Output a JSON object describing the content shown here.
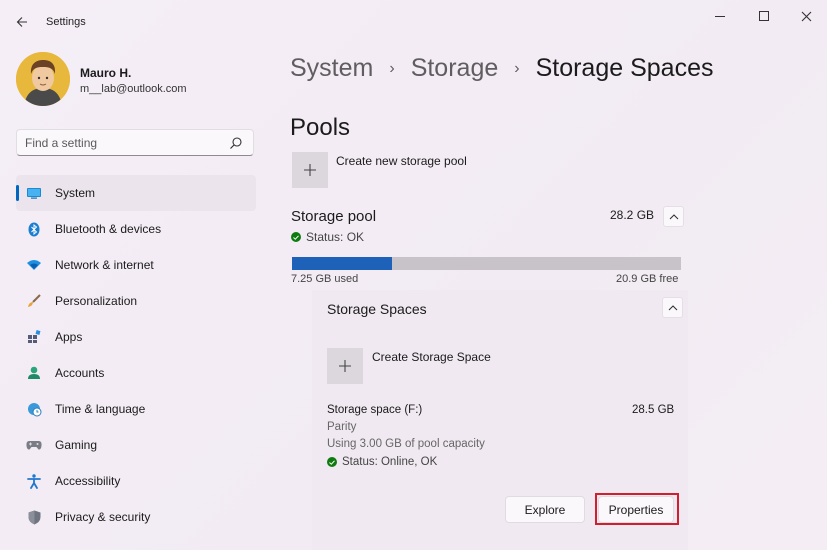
{
  "window": {
    "title": "Settings",
    "back_icon": "arrow-left-icon",
    "minimize_icon": "minimize-icon",
    "maximize_icon": "maximize-icon",
    "close_icon": "close-icon"
  },
  "profile": {
    "name": "Mauro H.",
    "email": "m__lab@outlook.com"
  },
  "search": {
    "placeholder": "Find a setting",
    "icon": "search-icon"
  },
  "nav": {
    "items": [
      {
        "label": "System",
        "icon": "monitor-icon",
        "active": true
      },
      {
        "label": "Bluetooth & devices",
        "icon": "bluetooth-icon"
      },
      {
        "label": "Network & internet",
        "icon": "wifi-icon"
      },
      {
        "label": "Personalization",
        "icon": "brush-icon"
      },
      {
        "label": "Apps",
        "icon": "apps-icon"
      },
      {
        "label": "Accounts",
        "icon": "person-icon"
      },
      {
        "label": "Time & language",
        "icon": "globe-clock-icon"
      },
      {
        "label": "Gaming",
        "icon": "gamepad-icon"
      },
      {
        "label": "Accessibility",
        "icon": "accessibility-icon"
      },
      {
        "label": "Privacy & security",
        "icon": "shield-icon"
      }
    ]
  },
  "breadcrumb": {
    "items": [
      "System",
      "Storage",
      "Storage Spaces"
    ],
    "separator": "›"
  },
  "pools": {
    "title": "Pools",
    "create_pool_label": "Create new storage pool",
    "pool": {
      "name": "Storage pool",
      "size": "28.2 GB",
      "status": "Status: OK",
      "used_label": "7.25 GB used",
      "free_label": "20.9 GB free",
      "used_fraction": 0.257
    }
  },
  "spaces": {
    "title": "Storage Spaces",
    "create_space_label": "Create Storage Space",
    "space": {
      "name": "Storage space (F:)",
      "size": "28.5 GB",
      "type": "Parity",
      "usage": "Using 3.00 GB of pool capacity",
      "status": "Status: Online, OK"
    },
    "explore_label": "Explore",
    "properties_label": "Properties"
  },
  "colors": {
    "accent": "#0067c0",
    "bar_fill": "#1d62b8",
    "status_ok": "#0f7b0f",
    "highlight": "#d0202e"
  }
}
